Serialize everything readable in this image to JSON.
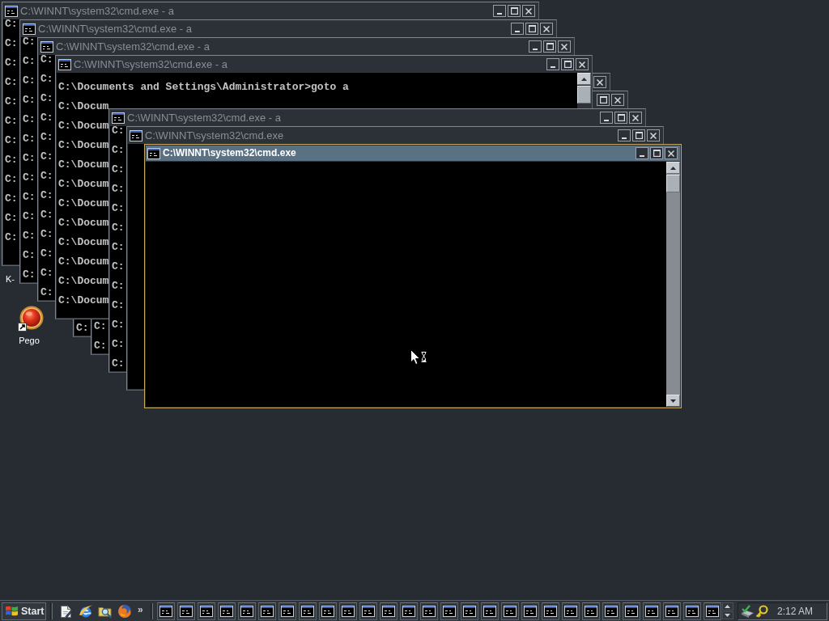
{
  "desktop": {
    "icons": [
      {
        "kind": "covered",
        "label": "K-"
      },
      {
        "kind": "shortcut",
        "label": "Pego"
      }
    ]
  },
  "windows": [
    {
      "title": "C:\\WINNT\\system32\\cmd.exe - a",
      "active": false,
      "buttons": [
        {
          "kind": "minimize"
        },
        {
          "kind": "maximize"
        },
        {
          "kind": "close"
        }
      ],
      "lines": [
        "C:",
        "C:",
        "C:",
        "C:",
        "C:",
        "C:",
        "C:",
        "C:",
        "C:",
        "C:",
        "C:",
        "C:"
      ]
    },
    {
      "title": "C:\\WINNT\\system32\\cmd.exe - a",
      "active": false,
      "buttons": [
        {
          "kind": "minimize"
        },
        {
          "kind": "maximize"
        },
        {
          "kind": "close"
        }
      ],
      "lines": [
        "C:",
        "C:",
        "C:",
        "C:",
        "C:",
        "C:",
        "C:",
        "C:",
        "C:",
        "C:",
        "C:",
        "C:",
        "C:"
      ]
    },
    {
      "title": "C:\\WINNT\\system32\\cmd.exe - a",
      "active": false,
      "buttons": [
        {
          "kind": "minimize"
        },
        {
          "kind": "maximize"
        },
        {
          "kind": "close"
        }
      ],
      "lines": [
        "C:",
        "C:",
        "C:",
        "C:",
        "C:",
        "C:",
        "C:",
        "C:",
        "C:",
        "C:",
        "C:",
        "C:",
        "C:"
      ]
    },
    {
      "title": "C:\\WINNT\\system32\\cmd.exe - a",
      "active": false,
      "buttons": [
        {
          "kind": "minimize"
        },
        {
          "kind": "maximize"
        },
        {
          "kind": "close"
        }
      ],
      "lines": [
        "C:\\Documents and Settings\\Administrator>goto a",
        "C:\\Docum",
        "C:\\Docum",
        "C:\\Docum",
        "C:\\Docum",
        "C:\\Docum",
        "C:\\Docum",
        "C:\\Docum",
        "C:\\Docum",
        "C:\\Docum",
        "C:\\Docum",
        "C:\\Docum"
      ]
    },
    {
      "active": false,
      "buttons": [
        {
          "kind": "close"
        }
      ],
      "lines": [
        "C:"
      ]
    },
    {
      "active": false,
      "buttons": [
        {
          "kind": "maximize"
        },
        {
          "kind": "close"
        }
      ],
      "lines": [
        "C:",
        "C:"
      ]
    },
    {
      "title": "C:\\WINNT\\system32\\cmd.exe - a",
      "active": false,
      "buttons": [
        {
          "kind": "minimize"
        },
        {
          "kind": "maximize"
        },
        {
          "kind": "close"
        }
      ],
      "lines": [
        "C:",
        "C:",
        "C:",
        "C:",
        "C:",
        "C:",
        "C:",
        "C:",
        "C:",
        "C:",
        "C:",
        "C:",
        "C:"
      ]
    },
    {
      "title": "C:\\WINNT\\system32\\cmd.exe",
      "active": false,
      "buttons": [
        {
          "kind": "minimize"
        },
        {
          "kind": "maximize"
        },
        {
          "kind": "close"
        }
      ]
    },
    {
      "title": "C:\\WINNT\\system32\\cmd.exe",
      "active": true,
      "buttons": [
        {
          "kind": "minimize"
        },
        {
          "kind": "maximize"
        },
        {
          "kind": "close"
        }
      ]
    }
  ],
  "taskbar": {
    "start_button": {
      "label": "Start"
    },
    "quick_launch_more": "»",
    "window_buttons": [
      {
        "kind": "console"
      },
      {
        "kind": "console"
      },
      {
        "kind": "console"
      },
      {
        "kind": "console"
      },
      {
        "kind": "console"
      },
      {
        "kind": "console"
      },
      {
        "kind": "console"
      },
      {
        "kind": "console"
      },
      {
        "kind": "console"
      },
      {
        "kind": "console"
      },
      {
        "kind": "console"
      },
      {
        "kind": "console"
      },
      {
        "kind": "console"
      },
      {
        "kind": "console"
      },
      {
        "kind": "console"
      },
      {
        "kind": "console"
      },
      {
        "kind": "console"
      },
      {
        "kind": "console"
      },
      {
        "kind": "console"
      },
      {
        "kind": "console"
      },
      {
        "kind": "console"
      },
      {
        "kind": "console"
      },
      {
        "kind": "console"
      },
      {
        "kind": "console"
      },
      {
        "kind": "console"
      },
      {
        "kind": "console"
      },
      {
        "kind": "console"
      },
      {
        "kind": "console"
      }
    ],
    "clock": "2:12 AM"
  }
}
